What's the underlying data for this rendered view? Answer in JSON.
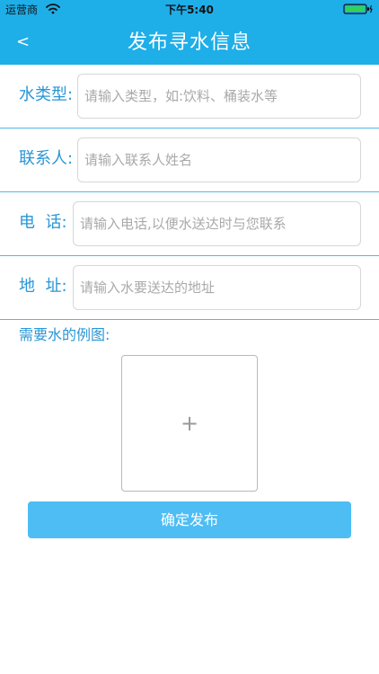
{
  "status_bar": {
    "carrier": "运营商",
    "time": "下午5:40"
  },
  "header": {
    "back_label": "<",
    "title": "发布寻水信息"
  },
  "form": {
    "rows": [
      {
        "label": "水类型:",
        "placeholder": "请输入类型，如:饮料、桶装水等"
      },
      {
        "label": "联系人:",
        "placeholder": "请输入联系人姓名"
      },
      {
        "label": "电  话:",
        "placeholder": "请输入电话,以便水送达时与您联系"
      },
      {
        "label": "地  址:",
        "placeholder": "请输入水要送达的地址"
      }
    ]
  },
  "image_upload": {
    "label": "需要水的例图:",
    "plus": "+"
  },
  "submit_label": "确定发布",
  "icons": {
    "wifi": "wifi-icon",
    "battery": "battery-icon",
    "back": "back-icon",
    "add": "plus-icon"
  },
  "colors": {
    "header_blue": "#1eaee8",
    "label_blue": "#2996d6",
    "divider_blue": "#52b7e6",
    "button_blue": "#4dbdf4",
    "battery_green": "#33d158"
  }
}
